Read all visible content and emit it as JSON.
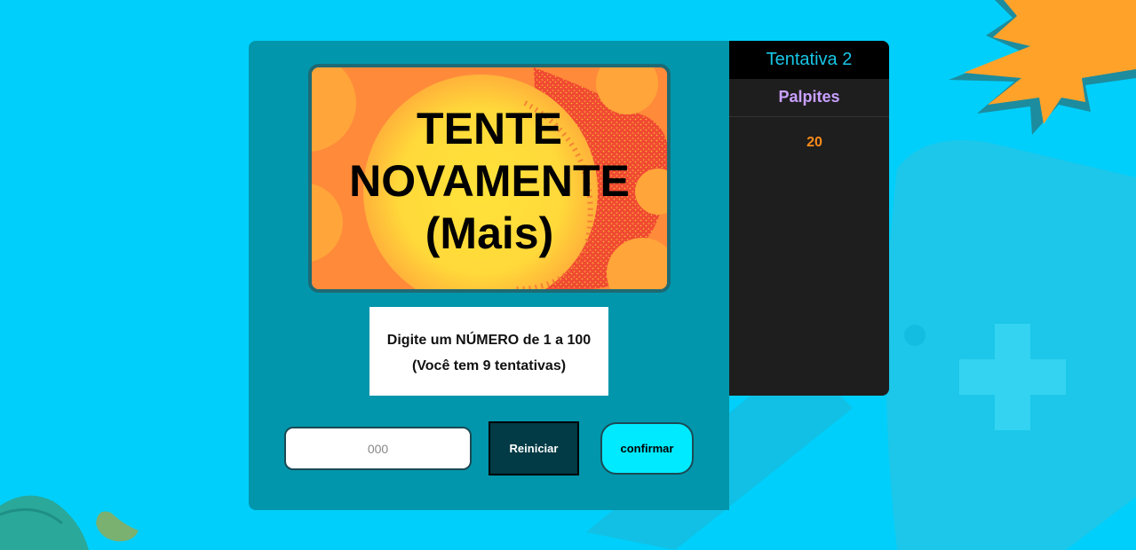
{
  "screen": {
    "message_line1": "TENTE",
    "message_line2": "NOVAMENTE",
    "message_line3": "(Mais)"
  },
  "instructions": {
    "line1": "Digite um NÚMERO de 1 a 100",
    "line2": "(Você tem 9 tentativas)"
  },
  "controls": {
    "guess_input_placeholder": "000",
    "guess_input_value": "",
    "restart_label": "Reiniciar",
    "confirm_label": "confirmar"
  },
  "side_panel": {
    "attempt_label": "Tentativa 2",
    "guesses_title": "Palpites",
    "guesses": [
      "20"
    ]
  },
  "colors": {
    "background": "#00cffb",
    "game_panel": "#0196ab",
    "side_panel": "#1e1e1e",
    "attempt_text": "#19c6e6",
    "guesses_title": "#c9a0ff",
    "guess_value": "#ff8c1a",
    "confirm_button": "#00eaff",
    "restart_button": "#023a45"
  },
  "icons": [
    "starburst-decoration",
    "gamepad-decoration",
    "wave-decoration"
  ]
}
